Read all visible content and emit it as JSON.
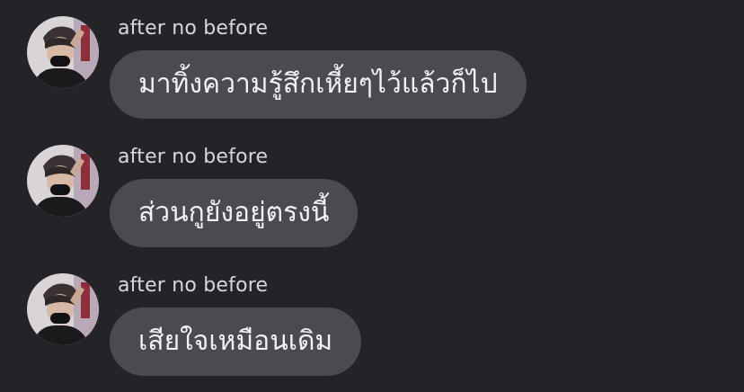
{
  "chat": {
    "messages": [
      {
        "sender": "after no before",
        "text": "มาทิ้งความรู้สึกเหี้ยๆไว้แล้วก็ไป"
      },
      {
        "sender": "after no before",
        "text": "ส่วนกูยังอยู่ตรงนี้"
      },
      {
        "sender": "after no before",
        "text": "เสียใจเหมือนเดิม"
      }
    ]
  },
  "colors": {
    "background": "#242428",
    "bubble": "#4a4a50",
    "sender_text": "#d8d8dc",
    "message_text": "#f2f2f4"
  },
  "icons": [
    "avatar-photo"
  ]
}
